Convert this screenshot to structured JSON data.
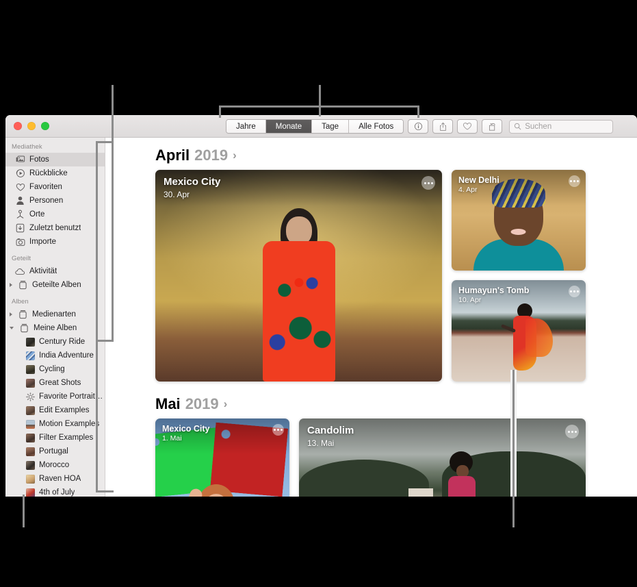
{
  "window": {
    "traffic_lights": [
      "close",
      "minimize",
      "zoom"
    ]
  },
  "toolbar": {
    "segments": [
      {
        "label": "Jahre",
        "active": false
      },
      {
        "label": "Monate",
        "active": true
      },
      {
        "label": "Tage",
        "active": false
      },
      {
        "label": "Alle Fotos",
        "active": false
      }
    ],
    "buttons": [
      {
        "name": "info-icon",
        "label": "Info"
      },
      {
        "name": "share-icon",
        "label": "Teilen"
      },
      {
        "name": "heart-icon",
        "label": "Favorit"
      },
      {
        "name": "rotate-icon",
        "label": "Drehen"
      }
    ],
    "search": {
      "placeholder": "Suchen",
      "value": ""
    }
  },
  "sidebar": {
    "groups": [
      {
        "title": "Mediathek",
        "items": [
          {
            "label": "Fotos",
            "icon": "photos-icon",
            "selected": true
          },
          {
            "label": "Rückblicke",
            "icon": "memories-icon",
            "selected": false
          },
          {
            "label": "Favoriten",
            "icon": "heart-icon",
            "selected": false
          },
          {
            "label": "Personen",
            "icon": "person-icon",
            "selected": false
          },
          {
            "label": "Orte",
            "icon": "places-pin-icon",
            "selected": false
          },
          {
            "label": "Zuletzt benutzt",
            "icon": "recents-icon",
            "selected": false
          },
          {
            "label": "Importe",
            "icon": "import-camera-icon",
            "selected": false
          }
        ]
      },
      {
        "title": "Geteilt",
        "items": [
          {
            "label": "Aktivität",
            "icon": "cloud-icon",
            "selected": false
          },
          {
            "label": "Geteilte Alben",
            "icon": "album-stack-icon",
            "selected": false,
            "disclosure": "closed"
          }
        ]
      },
      {
        "title": "Alben",
        "items": [
          {
            "label": "Medienarten",
            "icon": "album-stack-icon",
            "selected": false,
            "disclosure": "closed"
          },
          {
            "label": "Meine Alben",
            "icon": "album-stack-icon",
            "selected": false,
            "disclosure": "open"
          }
        ]
      }
    ],
    "my_albums": [
      {
        "label": "Century Ride",
        "thumb": "#3b3a36"
      },
      {
        "label": "India Adventure",
        "thumb": "#6f88b8"
      },
      {
        "label": "Cycling",
        "thumb": "#4a4637"
      },
      {
        "label": "Great Shots",
        "thumb": "#7a5c48"
      },
      {
        "label": "Favorite Portrait…",
        "thumb": "gear"
      },
      {
        "label": "Edit Examples",
        "thumb": "#7b5f52"
      },
      {
        "label": "Motion Examples",
        "thumb": "#8ea3b5"
      },
      {
        "label": "Filter Examples",
        "thumb": "#6b5549"
      },
      {
        "label": "Portugal",
        "thumb": "#7d5a4c"
      },
      {
        "label": "Morocco",
        "thumb": "#5b4c46"
      },
      {
        "label": "Raven HOA",
        "thumb": "#d6b489"
      },
      {
        "label": "4th of July",
        "thumb": "#c06a52"
      }
    ]
  },
  "content": {
    "months": [
      {
        "month": "April",
        "year": "2019",
        "chevron": "›",
        "cards": [
          {
            "title": "Mexico City",
            "date": "30. Apr",
            "size": "large",
            "scene": "mexico-wall"
          },
          {
            "title": "New Delhi",
            "date": "4. Apr",
            "size": "small",
            "scene": "new-delhi-portrait"
          },
          {
            "title": "Humayun's Tomb",
            "date": "10. Apr",
            "size": "small",
            "scene": "humayun-tomb"
          }
        ]
      },
      {
        "month": "Mai",
        "year": "2019",
        "chevron": "›",
        "cards": [
          {
            "title": "Mexico City",
            "date": "1. Mai",
            "size": "medium",
            "scene": "papel-picado"
          },
          {
            "title": "Candolim",
            "date": "13. Mai",
            "size": "wide",
            "scene": "candolim-road"
          }
        ]
      }
    ]
  }
}
